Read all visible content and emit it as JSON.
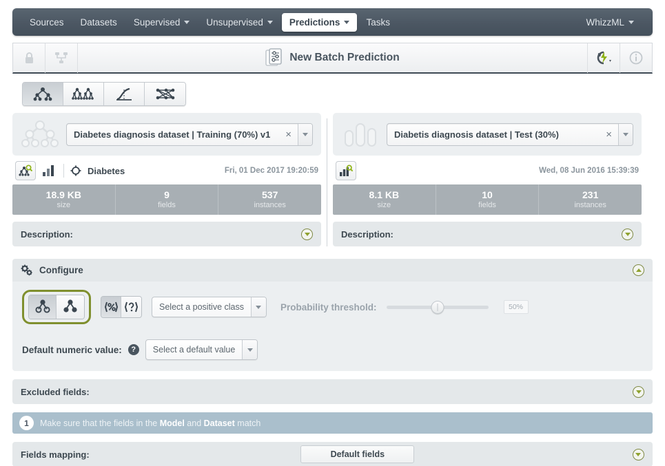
{
  "nav": {
    "items": [
      {
        "label": "Sources",
        "has_caret": false,
        "active": false
      },
      {
        "label": "Datasets",
        "has_caret": false,
        "active": false
      },
      {
        "label": "Supervised",
        "has_caret": true,
        "active": false
      },
      {
        "label": "Unsupervised",
        "has_caret": true,
        "active": false
      },
      {
        "label": "Predictions",
        "has_caret": true,
        "active": true
      },
      {
        "label": "Tasks",
        "has_caret": false,
        "active": false
      }
    ],
    "right": {
      "label": "WhizzML",
      "has_caret": true
    }
  },
  "header": {
    "title": "New Batch Prediction",
    "lock_icon": "lock-icon",
    "tree_icon": "sitemap-icon",
    "title_icon": "batch-prediction-icon",
    "action_icon": "lightning-cycle-icon",
    "info_icon": "info-icon"
  },
  "model_types": [
    {
      "name": "decision-tree",
      "selected": true
    },
    {
      "name": "ensemble",
      "selected": false
    },
    {
      "name": "logistic-regression",
      "selected": false
    },
    {
      "name": "deepnet",
      "selected": false
    }
  ],
  "left_panel": {
    "source_icon": "decision-tree-icon",
    "selector": {
      "value": "Diabetes diagnosis dataset | Training (70%) v1",
      "clear": "×"
    },
    "meta": {
      "model_icon": "model-search-icon",
      "chart_icon": "bar-chart-icon",
      "objective_icon": "target-icon",
      "objective": "Diabetes",
      "date": "Fri, 01 Dec 2017 19:20:59"
    },
    "stats": [
      {
        "value": "18.9 KB",
        "label": "size"
      },
      {
        "value": "9",
        "label": "fields"
      },
      {
        "value": "537",
        "label": "instances"
      }
    ],
    "description_label": "Description:"
  },
  "right_panel": {
    "source_icon": "bar-chart-icon",
    "selector": {
      "value": "Diabetis diagnosis dataset | Test (30%)",
      "clear": "×"
    },
    "meta": {
      "dataset_icon": "dataset-search-icon",
      "date": "Wed, 08 Jun 2016 15:39:39"
    },
    "stats": [
      {
        "value": "8.1 KB",
        "label": "size"
      },
      {
        "value": "10",
        "label": "fields"
      },
      {
        "value": "231",
        "label": "instances"
      }
    ],
    "description_label": "Description:"
  },
  "configure": {
    "title": "Configure",
    "gear_icon": "gears-icon",
    "collapse_icon": "chevron-up-circle-icon",
    "output_toggle": [
      {
        "name": "prediction-paths-all",
        "selected": true
      },
      {
        "name": "prediction-paths-single",
        "selected": false
      }
    ],
    "extra_toggle": [
      {
        "name": "percent-icon",
        "label": "{%}",
        "selected": true
      },
      {
        "name": "question-icon",
        "label": "{?}",
        "selected": false
      }
    ],
    "positive_class": {
      "value": "Select a positive class",
      "disabled": false
    },
    "threshold": {
      "label": "Probability threshold:",
      "value": "50%",
      "percent": 50,
      "disabled": true
    },
    "default_numeric": {
      "label": "Default numeric value:",
      "help_icon": "question-circle-icon",
      "value": "Select a default value"
    },
    "excluded_fields": {
      "label": "Excluded fields:",
      "expand_icon": "chevron-down-circle-icon"
    },
    "notice": {
      "number": "1",
      "text_before": "Make sure that the fields in the ",
      "bold1": "Model",
      "text_mid": " and ",
      "bold2": "Dataset",
      "text_after": " match"
    },
    "fields_mapping": {
      "label": "Fields mapping:",
      "button": "Default fields",
      "expand_icon": "chevron-down-circle-icon"
    }
  },
  "colors": {
    "nav_bg": "#4c5763",
    "accent_green": "#7f8f2e",
    "stats_bg": "#a8afb4",
    "notice_bg": "#aabfcc",
    "panel_bg": "#eceff1"
  }
}
